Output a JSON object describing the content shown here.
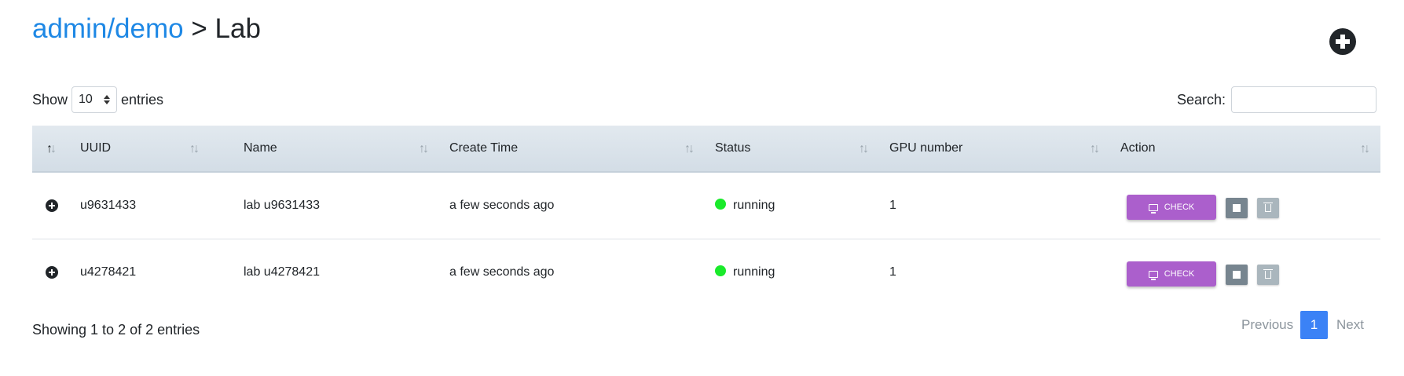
{
  "breadcrumb": {
    "parent": "admin/demo",
    "separator": ">",
    "current": "Lab"
  },
  "length_menu": {
    "prefix": "Show",
    "value": "10",
    "suffix": "entries"
  },
  "search": {
    "label": "Search:",
    "value": ""
  },
  "table": {
    "columns": [
      "UUID",
      "Name",
      "Create Time",
      "Status",
      "GPU number",
      "Action"
    ],
    "rows": [
      {
        "uuid": "u9631433",
        "name": "lab u9631433",
        "create_time": "a few seconds ago",
        "status": "running",
        "gpu": "1",
        "check_label": "CHECK"
      },
      {
        "uuid": "u4278421",
        "name": "lab u4278421",
        "create_time": "a few seconds ago",
        "status": "running",
        "gpu": "1",
        "check_label": "CHECK"
      }
    ]
  },
  "footer": {
    "info": "Showing 1 to 2 of 2 entries"
  },
  "pagination": {
    "previous": "Previous",
    "current_page": "1",
    "next": "Next"
  },
  "colors": {
    "link": "#1e88e5",
    "check_button": "#ab5fcc",
    "status_running": "#1aea2b",
    "active_page": "#3b82f6"
  },
  "icons": [
    "plus-circle-icon",
    "sort-icon",
    "expand-icon",
    "monitor-icon",
    "stop-icon",
    "trash-icon"
  ]
}
